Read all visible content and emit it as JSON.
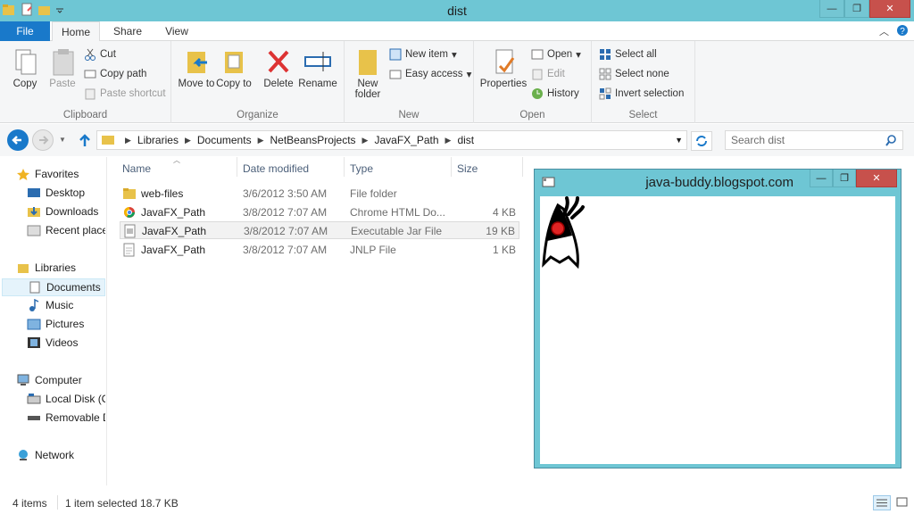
{
  "window": {
    "title": "dist",
    "minimize": "—",
    "maximize": "❐",
    "close": "✕"
  },
  "tabs": {
    "file": "File",
    "home": "Home",
    "share": "Share",
    "view": "View"
  },
  "ribbon": {
    "clipboard": {
      "copy": "Copy",
      "paste": "Paste",
      "cut": "Cut",
      "copy_path": "Copy path",
      "paste_shortcut": "Paste shortcut",
      "label": "Clipboard"
    },
    "organize": {
      "move_to": "Move to",
      "copy_to": "Copy to",
      "delete": "Delete",
      "rename": "Rename",
      "label": "Organize"
    },
    "new": {
      "new_folder": "New folder",
      "new_item": "New item",
      "easy_access": "Easy access",
      "label": "New"
    },
    "open": {
      "properties": "Properties",
      "open": "Open",
      "edit": "Edit",
      "history": "History",
      "label": "Open"
    },
    "select": {
      "select_all": "Select all",
      "select_none": "Select none",
      "invert": "Invert selection",
      "label": "Select"
    }
  },
  "address": {
    "crumbs": [
      "Libraries",
      "Documents",
      "NetBeansProjects",
      "JavaFX_Path",
      "dist"
    ],
    "search_placeholder": "Search dist"
  },
  "nav": {
    "favorites": "Favorites",
    "desktop": "Desktop",
    "downloads": "Downloads",
    "recent": "Recent places",
    "libraries": "Libraries",
    "documents": "Documents",
    "music": "Music",
    "pictures": "Pictures",
    "videos": "Videos",
    "computer": "Computer",
    "local_disk": "Local Disk (C:)",
    "removable": "Removable Disk",
    "network": "Network"
  },
  "columns": {
    "name": "Name",
    "date": "Date modified",
    "type": "Type",
    "size": "Size"
  },
  "files": [
    {
      "name": "web-files",
      "date": "3/6/2012 3:50 AM",
      "type": "File folder",
      "size": "",
      "icon": "folder-icon"
    },
    {
      "name": "JavaFX_Path",
      "date": "3/8/2012 7:07 AM",
      "type": "Chrome HTML Do...",
      "size": "4 KB",
      "icon": "chrome-icon"
    },
    {
      "name": "JavaFX_Path",
      "date": "3/8/2012 7:07 AM",
      "type": "Executable Jar File",
      "size": "19 KB",
      "icon": "jar-icon"
    },
    {
      "name": "JavaFX_Path",
      "date": "3/8/2012 7:07 AM",
      "type": "JNLP File",
      "size": "1 KB",
      "icon": "file-icon"
    }
  ],
  "status": {
    "items": "4 items",
    "selected": "1 item selected  18.7 KB"
  },
  "java_window": {
    "title": "java-buddy.blogspot.com",
    "minimize": "—",
    "maximize": "❐",
    "close": "✕"
  }
}
